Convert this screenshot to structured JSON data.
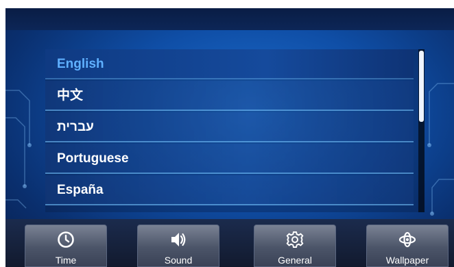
{
  "languages": {
    "items": [
      {
        "label": "English",
        "selected": true
      },
      {
        "label": "中文",
        "selected": false
      },
      {
        "label": "עברית",
        "selected": false
      },
      {
        "label": "Portuguese",
        "selected": false
      },
      {
        "label": "España",
        "selected": false
      }
    ]
  },
  "nav": {
    "time_label": "Time",
    "time_icon": "clock-icon",
    "sound_label": "Sound",
    "sound_icon": "speaker-icon",
    "general_label": "General",
    "general_icon": "gear-icon",
    "wallpaper_label": "Wallpaper",
    "wallpaper_icon": "wallpaper-icon"
  },
  "colors": {
    "selected_text": "#5fb0ff",
    "item_text": "#ffffff",
    "background": "#0f4ea6"
  }
}
